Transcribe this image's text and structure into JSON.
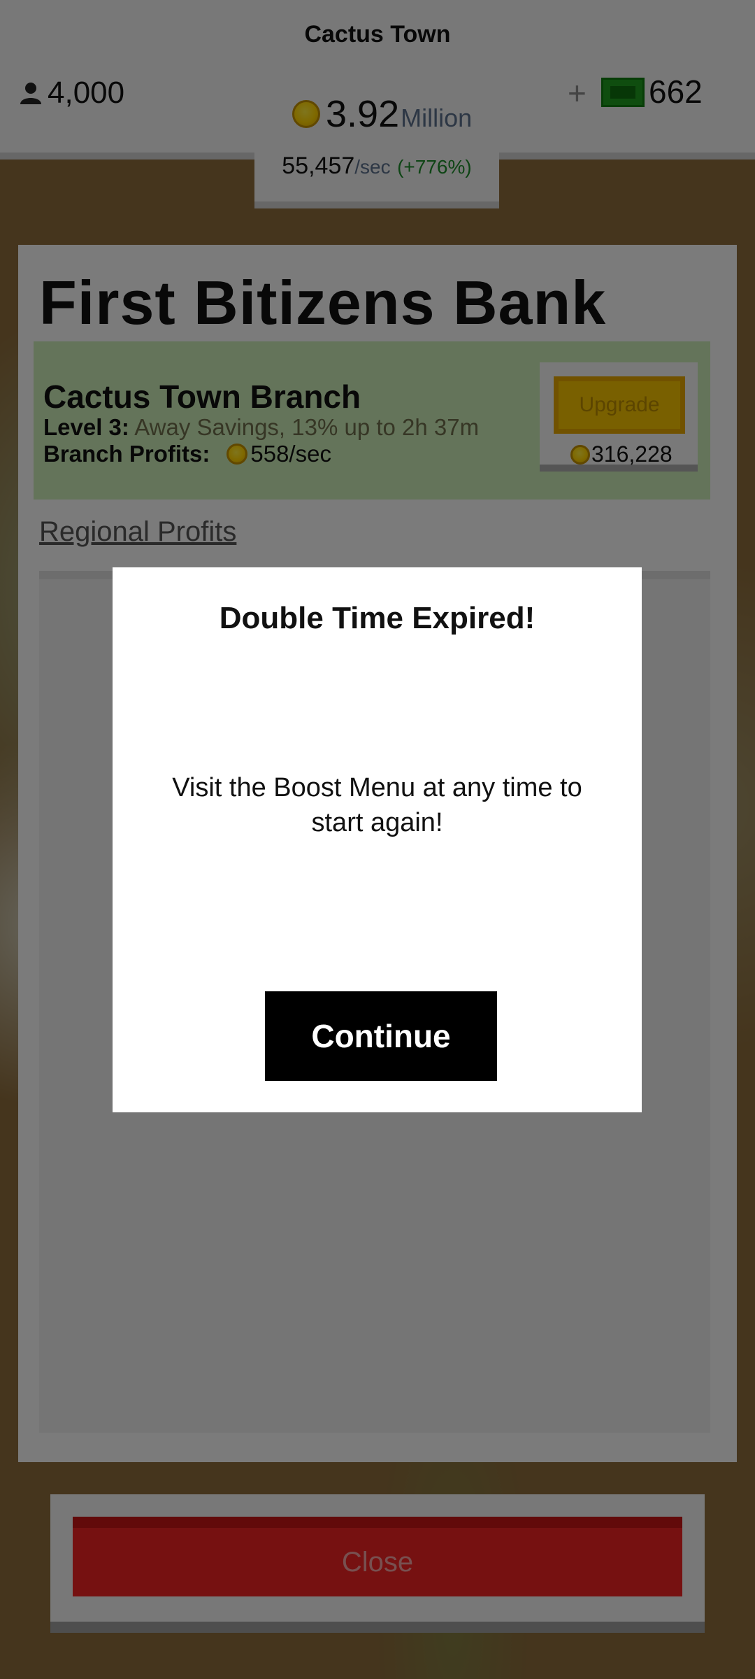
{
  "hud": {
    "town_name": "Cactus Town",
    "population": "4,000",
    "cash_value": "3.92",
    "cash_unit": "Million",
    "plus_label": "+",
    "bills_value": "662",
    "rate_value": "55,457",
    "rate_unit": "/sec",
    "rate_percent": "(+776%)"
  },
  "bank": {
    "title": "First Bitizens Bank",
    "branch_name": "Cactus Town Branch",
    "level_label": "Level 3:",
    "level_desc": "Away Savings, 13% up to 2h 37m",
    "profits_label": "Branch Profits:",
    "profits_value": "558/sec",
    "upgrade_label": "Upgrade",
    "upgrade_cost": "316,228",
    "regional_link": "Regional Profits"
  },
  "footer": {
    "close_label": "Close"
  },
  "modal": {
    "title": "Double Time Expired!",
    "message": "Visit the Boost Menu at any time to start again!",
    "continue_label": "Continue"
  },
  "colors": {
    "cash_unit": "#5a6f8a",
    "rate_percent": "#1d8a2a",
    "branch_bg": "#c9e8b4",
    "upgrade_button": "#f3c000",
    "close_button": "#ec2323",
    "bills": "#1f9a1f"
  },
  "icons": {
    "population": "person-icon",
    "coin": "coin-icon",
    "bills": "bills-icon"
  }
}
